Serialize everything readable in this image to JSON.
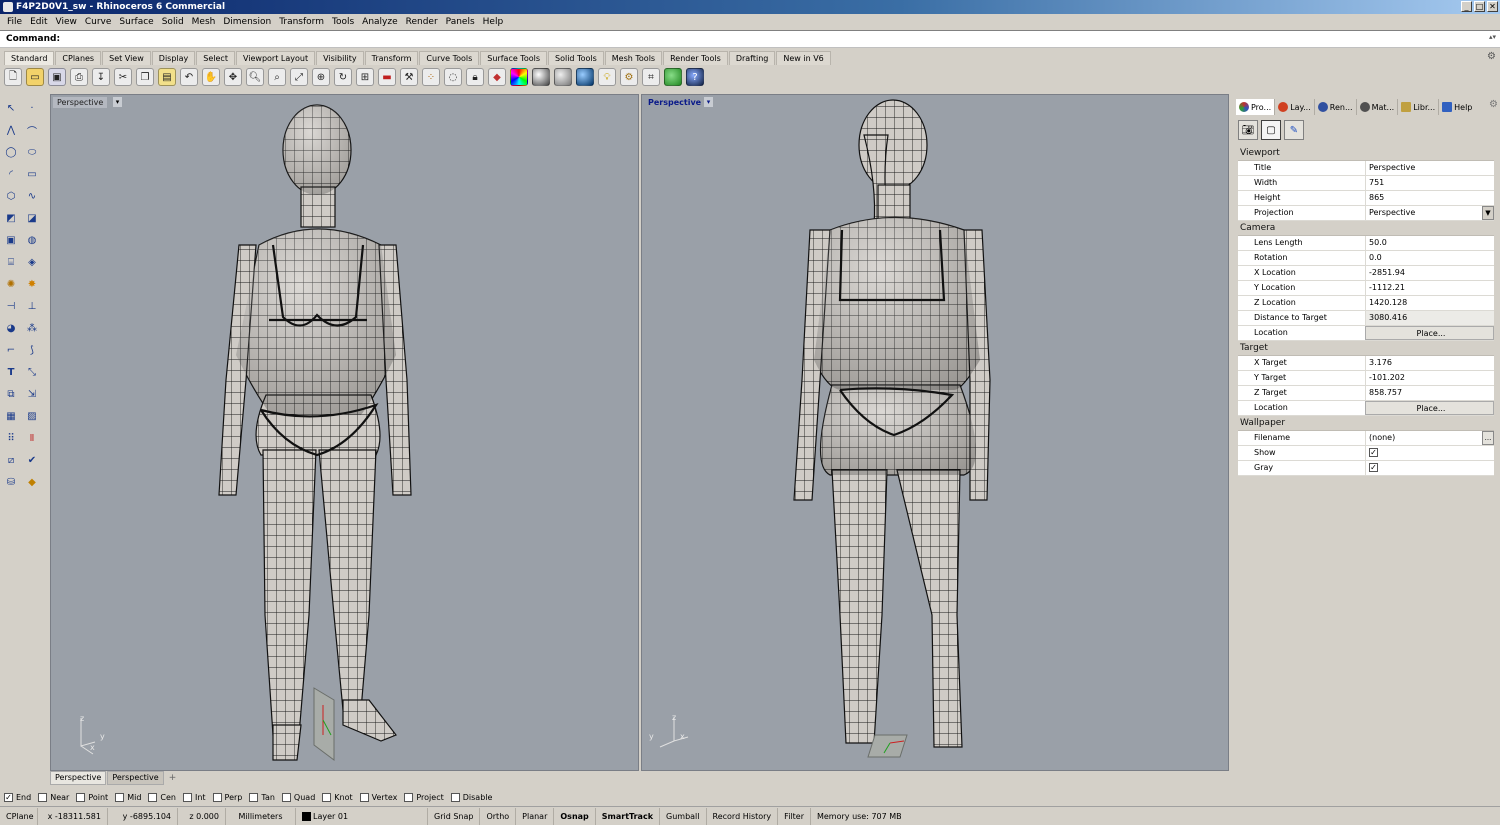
{
  "window": {
    "title": "F4P2D0V1_sw - Rhinoceros 6 Commercial",
    "min": "_",
    "max": "□",
    "close": "✕"
  },
  "menu": [
    "File",
    "Edit",
    "View",
    "Curve",
    "Surface",
    "Solid",
    "Mesh",
    "Dimension",
    "Transform",
    "Tools",
    "Analyze",
    "Render",
    "Panels",
    "Help"
  ],
  "command": {
    "label": "Command:"
  },
  "toolbar_tabs": [
    "Standard",
    "CPlanes",
    "Set View",
    "Display",
    "Select",
    "Viewport Layout",
    "Visibility",
    "Transform",
    "Curve Tools",
    "Surface Tools",
    "Solid Tools",
    "Mesh Tools",
    "Render Tools",
    "Drafting",
    "New in V6"
  ],
  "toolbar_icons": [
    "new-icon",
    "open-icon",
    "save-icon",
    "print-icon",
    "import-icon",
    "cut-icon",
    "copy-icon",
    "paste-icon",
    "undo-icon",
    "pan-icon",
    "move-icon",
    "zoom-icon",
    "zoom-window-icon",
    "zoom-extents-icon",
    "zoom-selected-icon",
    "rotate-view-icon",
    "four-viewports-icon",
    "car-icon",
    "properties-icon",
    "points-icon",
    "light-icon",
    "lock-icon",
    "material-icon",
    "color-wheel-icon",
    "sphere-icon",
    "shaded-icon",
    "render-icon",
    "light-bulb-icon",
    "settings-gear-icon",
    "grid-icon",
    "globe-icon",
    "help-icon"
  ],
  "viewports": {
    "left": {
      "label": "Perspective"
    },
    "right": {
      "label": "Perspective"
    }
  },
  "axes": {
    "x": "x",
    "y": "y",
    "z": "z"
  },
  "bottom_tabs": [
    "Perspective",
    "Perspective"
  ],
  "add_tab": "+",
  "osnaps": [
    {
      "label": "End",
      "checked": true
    },
    {
      "label": "Near",
      "checked": false
    },
    {
      "label": "Point",
      "checked": false
    },
    {
      "label": "Mid",
      "checked": false
    },
    {
      "label": "Cen",
      "checked": false
    },
    {
      "label": "Int",
      "checked": false
    },
    {
      "label": "Perp",
      "checked": false
    },
    {
      "label": "Tan",
      "checked": false
    },
    {
      "label": "Quad",
      "checked": false
    },
    {
      "label": "Knot",
      "checked": false
    },
    {
      "label": "Vertex",
      "checked": false
    },
    {
      "label": "Project",
      "checked": false
    },
    {
      "label": "Disable",
      "checked": false
    }
  ],
  "status": {
    "cplane": "CPlane",
    "x": "x -18311.581",
    "y": "y -6895.104",
    "z": "z 0.000",
    "units": "Millimeters",
    "layer": "Layer 01",
    "grid_snap": "Grid Snap",
    "ortho": "Ortho",
    "planar": "Planar",
    "osnap": "Osnap",
    "smarttrack": "SmartTrack",
    "gumball": "Gumball",
    "record_history": "Record History",
    "filter": "Filter",
    "memory": "Memory use: 707 MB"
  },
  "panel_tabs": [
    {
      "label": "Pro...",
      "color": "#c03030"
    },
    {
      "label": "Lay...",
      "color": "#d04020"
    },
    {
      "label": "Ren...",
      "color": "#3050a0"
    },
    {
      "label": "Mat...",
      "color": "#505050"
    },
    {
      "label": "Libr...",
      "color": "#c0a040"
    },
    {
      "label": "Help",
      "color": "#3060c0"
    }
  ],
  "properties": {
    "viewport": {
      "header": "Viewport",
      "title_label": "Title",
      "title_value": "Perspective",
      "width_label": "Width",
      "width_value": "751",
      "height_label": "Height",
      "height_value": "865",
      "projection_label": "Projection",
      "projection_value": "Perspective"
    },
    "camera": {
      "header": "Camera",
      "lens_label": "Lens Length",
      "lens_value": "50.0",
      "rotation_label": "Rotation",
      "rotation_value": "0.0",
      "xloc_label": "X Location",
      "xloc_value": "-2851.94",
      "yloc_label": "Y Location",
      "yloc_value": "-1112.21",
      "zloc_label": "Z Location",
      "zloc_value": "1420.128",
      "dist_label": "Distance to Target",
      "dist_value": "3080.416",
      "location_label": "Location",
      "location_button": "Place..."
    },
    "target": {
      "header": "Target",
      "xt_label": "X Target",
      "xt_value": "3.176",
      "yt_label": "Y Target",
      "yt_value": "-101.202",
      "zt_label": "Z Target",
      "zt_value": "858.757",
      "location_label": "Location",
      "location_button": "Place..."
    },
    "wallpaper": {
      "header": "Wallpaper",
      "filename_label": "Filename",
      "filename_value": "(none)",
      "filename_button": "...",
      "show_label": "Show",
      "show_checked": "✓",
      "gray_label": "Gray",
      "gray_checked": "✓"
    }
  }
}
